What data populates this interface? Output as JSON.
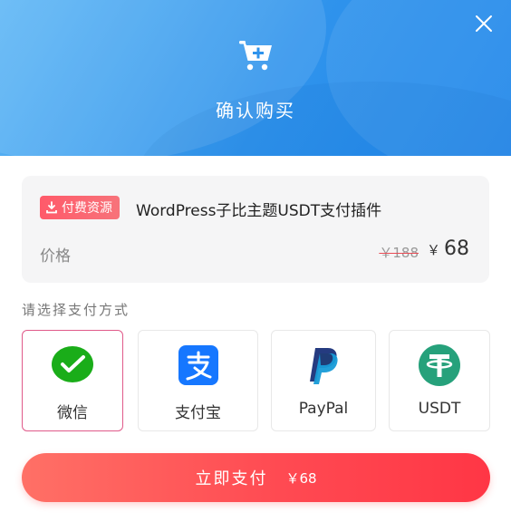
{
  "header": {
    "title": "确认购买",
    "cart_icon": "cart-plus-icon",
    "close_icon": "close-icon",
    "gradient_colors": [
      "#5fb7f5",
      "#1f86ea"
    ]
  },
  "product": {
    "tag_label": "付费资源",
    "tag_icon": "download-icon",
    "title": "WordPress子比主题USDT支付插件",
    "price_label": "价格",
    "original_price": "￥188",
    "current_price_symbol": "￥",
    "current_price": "68"
  },
  "payment": {
    "label": "请选择支付方式",
    "selected": "微信",
    "methods": [
      {
        "label": "微信",
        "icon": "wechat-pay-icon",
        "color": "#1aad19"
      },
      {
        "label": "支付宝",
        "icon": "alipay-icon",
        "color": "#1677ff"
      },
      {
        "label": "PayPal",
        "icon": "paypal-icon",
        "color": "#253b80"
      },
      {
        "label": "USDT",
        "icon": "usdt-tether-icon",
        "color": "#26a17b"
      }
    ]
  },
  "submit": {
    "label": "立即支付",
    "amount": "￥68",
    "gradient_colors": [
      "#ff7066",
      "#ff3645"
    ]
  }
}
